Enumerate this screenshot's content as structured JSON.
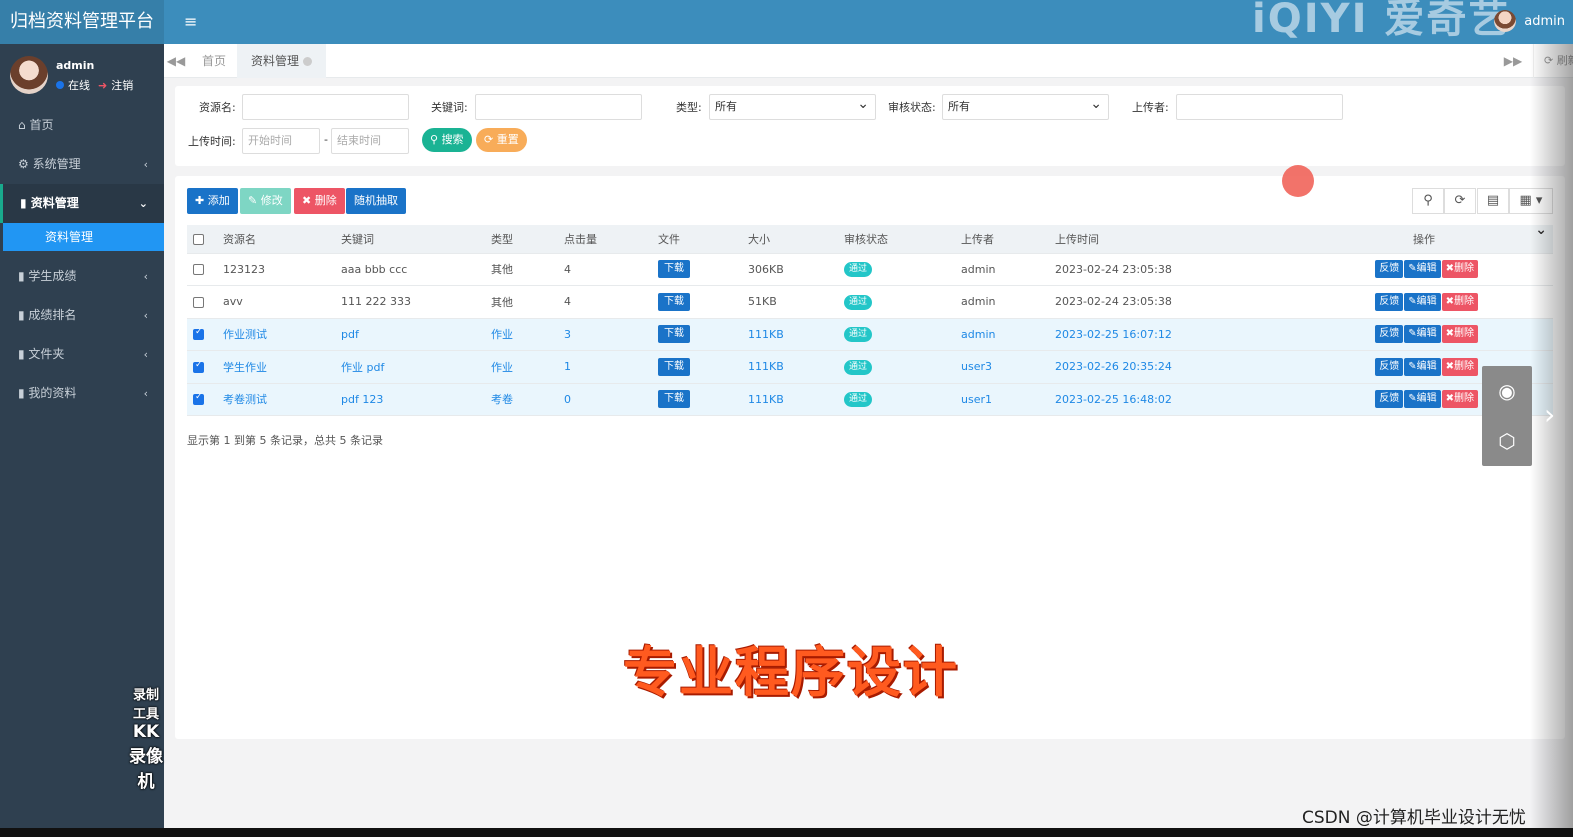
{
  "app": {
    "title": "归档资料管理平台",
    "watermark": "iQIYI 爱奇艺"
  },
  "header": {
    "username": "admin"
  },
  "sidebar": {
    "user": {
      "name": "admin",
      "status_online": "在线",
      "logout": "注销"
    },
    "items": [
      {
        "label": "首页",
        "icon": "home-icon"
      },
      {
        "label": "系统管理",
        "icon": "gear-icon"
      },
      {
        "label": "资料管理",
        "icon": "book-icon"
      },
      {
        "label": "学生成绩",
        "icon": "book-icon"
      },
      {
        "label": "成绩排名",
        "icon": "book-icon"
      },
      {
        "label": "文件夹",
        "icon": "book-icon"
      },
      {
        "label": "我的资料",
        "icon": "book-icon"
      }
    ],
    "sub_active": "资料管理"
  },
  "tabs": {
    "home": "首页",
    "current": "资料管理",
    "refresh": "刷新"
  },
  "search": {
    "resource_name_label": "资源名:",
    "keyword_label": "关键词:",
    "type_label": "类型:",
    "type_value": "所有",
    "review_label": "审核状态:",
    "review_value": "所有",
    "uploader_label": "上传者:",
    "upload_time_label": "上传时间:",
    "start_placeholder": "开始时间",
    "end_placeholder": "结束时间",
    "dash": "-",
    "search_button": "搜索",
    "reset_button": "重置"
  },
  "toolbar": {
    "add": "添加",
    "edit": "修改",
    "delete": "删除",
    "random": "随机抽取"
  },
  "table": {
    "headers": [
      "资源名",
      "关键词",
      "类型",
      "点击量",
      "文件",
      "大小",
      "审核状态",
      "上传者",
      "上传时间",
      "操作"
    ],
    "rows": [
      {
        "checked": false,
        "name": "123123",
        "keywords": "aaa bbb ccc",
        "type": "其他",
        "clicks": "4",
        "file": "下载",
        "size": "306KB",
        "status": "通过",
        "uploader": "admin",
        "time": "2023-02-24 23:05:38"
      },
      {
        "checked": false,
        "name": "avv",
        "keywords": "111 222 333",
        "type": "其他",
        "clicks": "4",
        "file": "下载",
        "size": "51KB",
        "status": "通过",
        "uploader": "admin",
        "time": "2023-02-24 23:05:38"
      },
      {
        "checked": true,
        "name": "作业测试",
        "keywords": "pdf",
        "type": "作业",
        "clicks": "3",
        "file": "下载",
        "size": "111KB",
        "status": "通过",
        "uploader": "admin",
        "time": "2023-02-25 16:07:12"
      },
      {
        "checked": true,
        "name": "学生作业",
        "keywords": "作业 pdf",
        "type": "作业",
        "clicks": "1",
        "file": "下载",
        "size": "111KB",
        "status": "通过",
        "uploader": "user3",
        "time": "2023-02-26 20:35:24"
      },
      {
        "checked": true,
        "name": "考卷测试",
        "keywords": "pdf 123",
        "type": "考卷",
        "clicks": "0",
        "file": "下载",
        "size": "111KB",
        "status": "通过",
        "uploader": "user1",
        "time": "2023-02-25 16:48:02"
      }
    ],
    "row_ops": {
      "feedback": "反馈",
      "edit": "编辑",
      "delete": "删除"
    },
    "footer": "显示第 1 到第 5 条记录，总共 5 条记录"
  },
  "overlay": {
    "caption": "专业程序设计",
    "recorder_line1": "录制工具",
    "recorder_line2": "KK 录像机",
    "csdn": "CSDN @计算机毕业设计无忧"
  },
  "colors": {
    "header": "#3c8dbc",
    "sidebar": "#2f4050",
    "primary": "#1a73c8",
    "success": "#19aa8d",
    "danger": "#ed5565",
    "warning": "#f8ac59",
    "info": "#23c6c8"
  }
}
